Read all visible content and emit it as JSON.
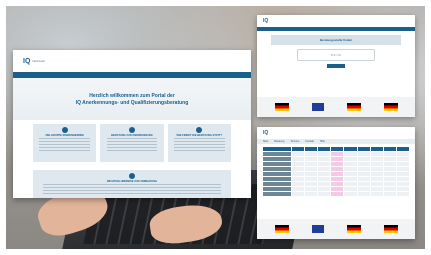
{
  "brand": {
    "logo_text": "IQ",
    "logo_tagline": "Netzwerk"
  },
  "main_portal": {
    "welcome_line_1": "Herzlich willkommen zum Portal der",
    "welcome_line_2": "IQ Anerkennungs- und Qualifizierungsberatung",
    "tiles": [
      {
        "title": "ZIELGRUPPE EINWANDERNDE"
      },
      {
        "title": "BERATUNG ZUR ANERKENNUNG"
      },
      {
        "title": "WIE FINDET DIE BERATUNG STATT?"
      }
    ],
    "band_title": "WICHTIGE HINWEISE ZUR ANMELDUNG"
  },
  "search_screen": {
    "title": "Beratungsstelle finden",
    "search_placeholder": "PLZ / Ort",
    "search_button": ""
  },
  "table_screen": {
    "nav_items": [
      "Start",
      "Beratung",
      "Termine",
      "Kontakt",
      "Hilfe"
    ],
    "rows": 10,
    "highlight_col": 3
  },
  "colors": {
    "primary": "#1b5f8d",
    "tile_bg": "#dfe8ee",
    "highlight": "#f3c9e5"
  }
}
